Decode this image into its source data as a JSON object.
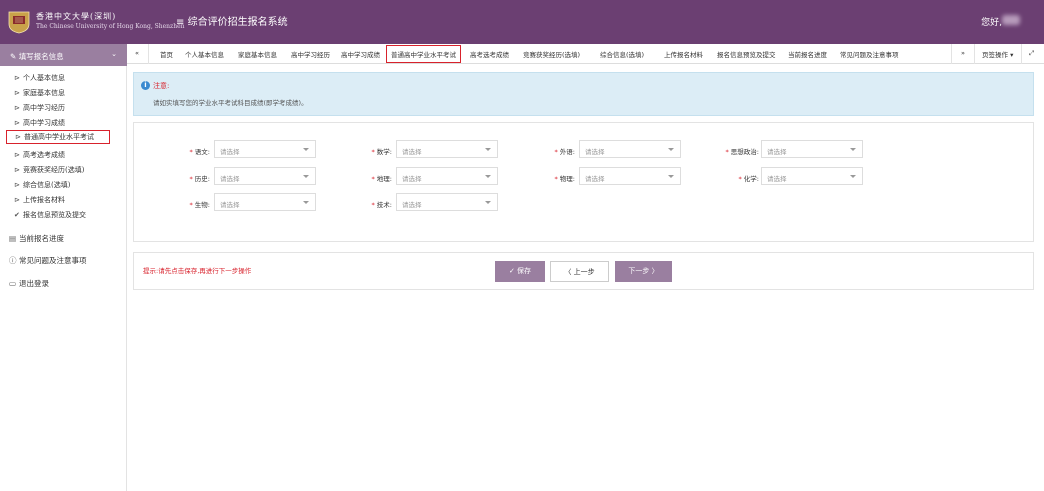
{
  "header": {
    "logo_cn": "香港中文大學(深圳)",
    "logo_en": "The Chinese University of Hong Kong, Shenzhen",
    "menu_icon": "hamburger-icon",
    "title": "综合评价招生报名系统",
    "greeting": "您好,"
  },
  "sidebar": {
    "section_label": "填写报名信息",
    "items": [
      {
        "label": "个人基本信息"
      },
      {
        "label": "家庭基本信息"
      },
      {
        "label": "高中学习经历"
      },
      {
        "label": "高中学习成绩"
      },
      {
        "label": "普通高中学业水平考试"
      },
      {
        "label": "高考选考成绩"
      },
      {
        "label": "竞赛获奖经历(选填)"
      },
      {
        "label": "综合信息(选填)"
      },
      {
        "label": "上传报名材料"
      },
      {
        "label": "报名信息预览及提交"
      }
    ],
    "progress_label": "当前报名进度",
    "faq_label": "常见问题及注意事项",
    "logout_label": "退出登录"
  },
  "tabs": {
    "back_icon": "«",
    "items": [
      {
        "label": "首页"
      },
      {
        "label": "个人基本信息"
      },
      {
        "label": "家庭基本信息"
      },
      {
        "label": "高中学习经历"
      },
      {
        "label": "高中学习成绩"
      },
      {
        "label": "普通高中学业水平考试"
      },
      {
        "label": "高考选考成绩"
      },
      {
        "label": "竞赛获奖经历(选填)"
      },
      {
        "label": "综合信息(选填)"
      },
      {
        "label": "上传报名材料"
      },
      {
        "label": "报名信息预览及提交"
      },
      {
        "label": "当前报名进度"
      },
      {
        "label": "常见问题及注意事项"
      }
    ],
    "forward_icon": "»",
    "page_ops_label": "页签操作",
    "fullscreen_icon": "⤢"
  },
  "notice": {
    "title": "注意:",
    "text": "请如实填写您的学业水平考试科目成绩(即学考成绩)。"
  },
  "form": {
    "placeholder": "请选择",
    "fields": [
      {
        "label": "语文:"
      },
      {
        "label": "数学:"
      },
      {
        "label": "外语:"
      },
      {
        "label": "思想政治:"
      },
      {
        "label": "历史:"
      },
      {
        "label": "地理:"
      },
      {
        "label": "物理:"
      },
      {
        "label": "化学:"
      },
      {
        "label": "生物:"
      },
      {
        "label": "技术:"
      }
    ]
  },
  "actions": {
    "hint": "提示:请先点击保存,再进行下一步操作",
    "save_label": "保存",
    "prev_label": "上一步",
    "next_label": "下一步"
  },
  "colors": {
    "brand_purple": "#6b3f72",
    "button_purple": "#9a7fa0",
    "highlight_red": "#d8222c",
    "notice_bg": "#dcedf6"
  }
}
